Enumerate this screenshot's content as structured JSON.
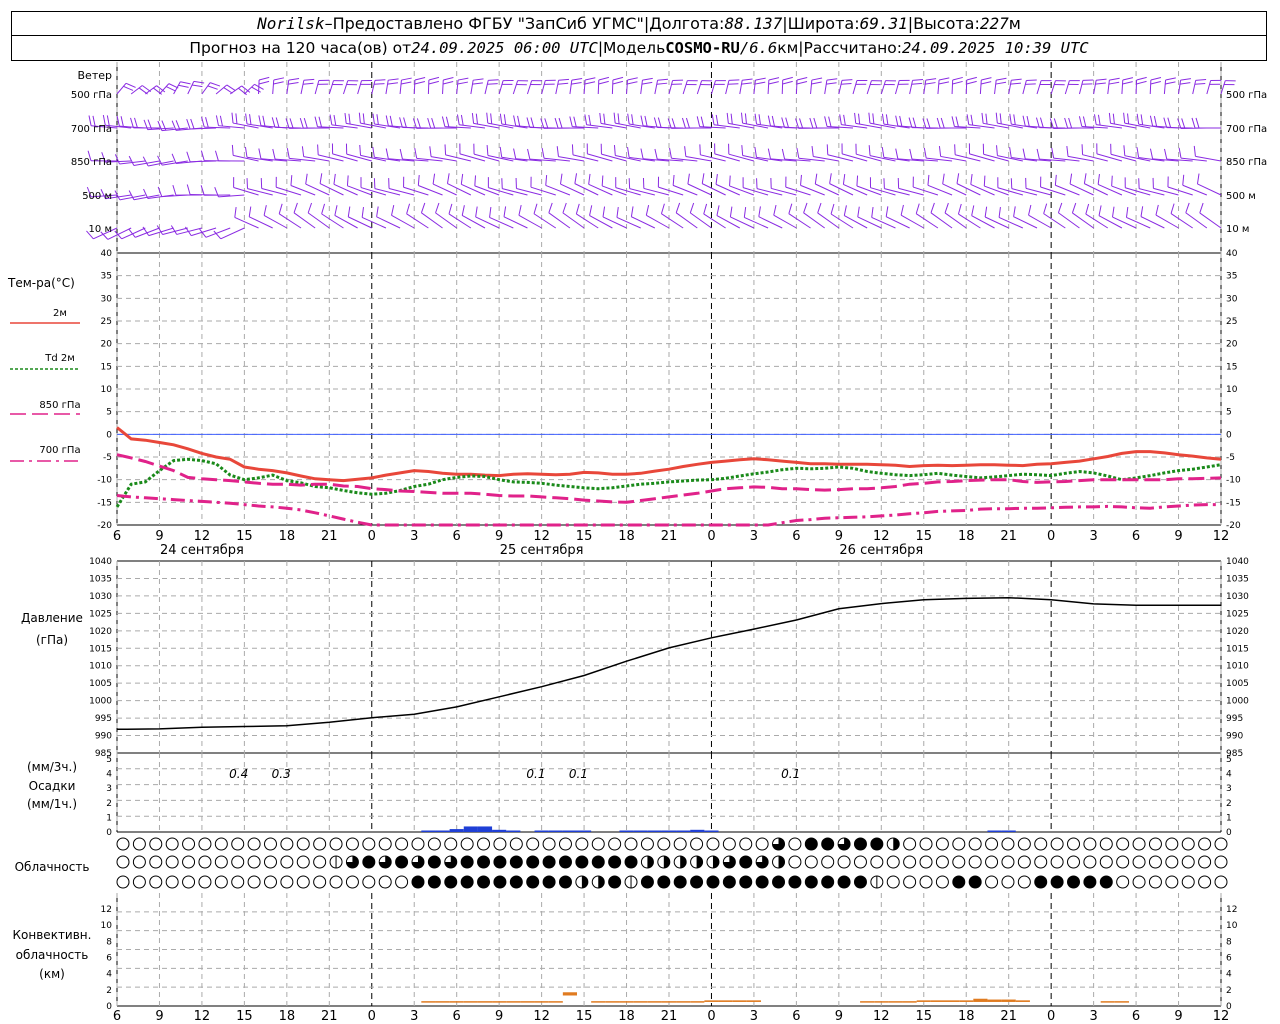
{
  "header": {
    "station": "Norilsk",
    "dash": " – ",
    "provider": "Предоставлено ФГБУ \"ЗапСиб УГМС\"",
    "sep": " | ",
    "lon_label": "Долгота: ",
    "lon_value": "88.137",
    "lat_label": "Широта: ",
    "lat_value": "69.31",
    "alt_label": "Высота: ",
    "alt_value": "227",
    "alt_unit": "м",
    "forecast_prefix": "Прогноз на 120 часа(ов) от ",
    "forecast_start": "24.09.2025 06:00 UTC",
    "model_label": "Модель ",
    "model_name": "COSMO-RU",
    "model_sep": " / ",
    "model_res": "6.6",
    "model_res_unit": "км",
    "computed_label": "Рассчитано: ",
    "computed_time": "24.09.2025 10:39 UTC"
  },
  "wind_panel": {
    "title": "Ветер",
    "levels": [
      "500 гПа",
      "700 гПа",
      "850 гПа",
      "500  м",
      "10   м"
    ],
    "color": "#8a2be2"
  },
  "temp_panel": {
    "title": "Тем-ра(°C)",
    "ylim": [
      -20,
      40
    ],
    "yticks": [
      40,
      35,
      30,
      25,
      20,
      15,
      10,
      5,
      0,
      -5,
      -10,
      -15,
      -20
    ]
  },
  "time_axis": {
    "hours": [
      "6",
      "9",
      "12",
      "15",
      "18",
      "21",
      "0",
      "3",
      "6",
      "9",
      "12",
      "15",
      "18",
      "21",
      "0",
      "3",
      "6",
      "9",
      "12",
      "15",
      "18",
      "21",
      "0",
      "3",
      "6",
      "9",
      "12"
    ],
    "dates": [
      "24 сентября",
      "25 сентября",
      "26 сентября"
    ]
  },
  "pressure_panel": {
    "title": "Давление",
    "unit": "(гПа)",
    "ylim": [
      985,
      1040
    ],
    "yticks": [
      1040,
      1035,
      1030,
      1025,
      1020,
      1015,
      1010,
      1005,
      1000,
      995,
      990,
      985
    ]
  },
  "precip_panel": {
    "unit_3h": "(мм/3ч.)",
    "title": "Осадки",
    "unit_1h": "(мм/1ч.)",
    "yticks": [
      5,
      4,
      3,
      2,
      1,
      0
    ],
    "labels": [
      {
        "hour": 8.6,
        "text": "0.4"
      },
      {
        "hour": 11.6,
        "text": "0.3"
      },
      {
        "hour": 29.6,
        "text": "0.1"
      },
      {
        "hour": 32.6,
        "text": "0.1"
      },
      {
        "hour": 47.6,
        "text": "0.1"
      }
    ],
    "color": "#1f3fd6"
  },
  "cloud_panel": {
    "title": "Облачность"
  },
  "conv_panel": {
    "title_line1": "Конвективн.",
    "title_line2": "облачность",
    "unit": "(км)",
    "yticks": [
      12,
      10,
      8,
      6,
      4,
      2,
      0
    ],
    "color": "#e07b20"
  },
  "chart_data": [
    {
      "type": "line",
      "title": "Тем-ра(°C)",
      "x_hours_from_start": [
        0,
        1,
        2,
        3,
        4,
        5,
        6,
        7,
        8,
        9,
        10,
        11,
        12,
        13,
        14,
        15,
        16,
        17,
        18,
        19,
        20,
        21,
        22,
        23,
        24,
        25,
        26,
        27,
        28,
        29,
        30,
        31,
        32,
        33,
        34,
        35,
        36,
        37,
        38,
        39,
        40,
        41,
        42,
        43,
        44,
        45,
        46,
        47,
        48,
        49,
        50,
        51,
        52,
        53,
        54,
        55,
        56,
        57,
        58,
        59,
        60,
        61,
        62,
        63,
        64,
        65,
        66,
        67,
        68,
        69,
        70,
        71,
        72,
        73,
        74,
        75,
        76,
        77,
        78
      ],
      "ylim": [
        -20,
        40
      ],
      "series": [
        {
          "name": "2м",
          "color": "#e8473a",
          "dash": "solid",
          "width": 3,
          "values": [
            1.5,
            -1,
            -1.3,
            -1.8,
            -2.3,
            -3.2,
            -4.2,
            -5,
            -5.5,
            -7.2,
            -7.7,
            -8,
            -8.5,
            -9.2,
            -9.8,
            -10,
            -10.2,
            -9.9,
            -9.6,
            -9,
            -8.5,
            -8,
            -8.2,
            -8.6,
            -8.8,
            -8.8,
            -9,
            -9.1,
            -8.8,
            -8.7,
            -8.8,
            -8.9,
            -8.8,
            -8.4,
            -8.5,
            -8.8,
            -8.8,
            -8.6,
            -8.1,
            -7.7,
            -7.1,
            -6.6,
            -6.2,
            -5.9,
            -5.6,
            -5.4,
            -5.6,
            -5.9,
            -6.2,
            -6.5,
            -6.5,
            -6.6,
            -6.6,
            -6.6,
            -6.7,
            -6.8,
            -7.1,
            -6.9,
            -6.8,
            -6.9,
            -6.8,
            -6.7,
            -6.7,
            -6.8,
            -6.9,
            -6.6,
            -6.5,
            -6.2,
            -5.9,
            -5.4,
            -4.9,
            -4.2,
            -3.8,
            -3.8,
            -4.1,
            -4.5,
            -4.8,
            -5.2,
            -5.5
          ]
        },
        {
          "name": "Td  2м",
          "color": "#1a8a1a",
          "dash": "dot",
          "width": 3,
          "values": [
            -16,
            -11,
            -10.5,
            -8,
            -5.8,
            -5.5,
            -5.8,
            -6.5,
            -9,
            -10,
            -9.6,
            -9,
            -10.2,
            -10.7,
            -11.5,
            -11.8,
            -12.4,
            -12.9,
            -13.2,
            -13,
            -12.4,
            -11.5,
            -11,
            -10,
            -9.5,
            -9.2,
            -9.3,
            -10,
            -10.5,
            -10.6,
            -10.8,
            -11.2,
            -11.5,
            -11.8,
            -12,
            -11.8,
            -11.4,
            -11,
            -10.8,
            -10.5,
            -10.3,
            -10.1,
            -10,
            -9.7,
            -9.2,
            -8.7,
            -8.3,
            -7.8,
            -7.5,
            -7.6,
            -7.5,
            -7.2,
            -7.5,
            -8.2,
            -8.6,
            -8.9,
            -9.1,
            -8.9,
            -8.6,
            -9,
            -9.3,
            -9.6,
            -9.4,
            -9.1,
            -8.8,
            -8.9,
            -9.1,
            -8.6,
            -8.2,
            -8.5,
            -9.2,
            -10,
            -9.6,
            -9.1,
            -8.5,
            -8,
            -7.7,
            -7.2,
            -6.7
          ]
        },
        {
          "name": "850 гПа",
          "color": "#e0228a",
          "dash": "long-dash",
          "width": 3,
          "values": [
            -4.5,
            -5.2,
            -6,
            -7,
            -8,
            -9.5,
            -9.8,
            -10,
            -10.2,
            -10.5,
            -10.8,
            -11,
            -11,
            -11.2,
            -11,
            -11,
            -11.4,
            -11.5,
            -12,
            -12.2,
            -12.5,
            -12.6,
            -12.8,
            -13,
            -13,
            -13,
            -13.2,
            -13.5,
            -13.6,
            -13.6,
            -13.8,
            -14,
            -14.2,
            -14.5,
            -14.7,
            -14.9,
            -15,
            -14.6,
            -14.2,
            -13.8,
            -13.4,
            -13,
            -12.5,
            -12,
            -11.8,
            -11.6,
            -11.7,
            -12,
            -12,
            -12.2,
            -12.3,
            -12.2,
            -12,
            -12,
            -11.8,
            -11.5,
            -11,
            -10.8,
            -10.5,
            -10.4,
            -10.2,
            -10.1,
            -10,
            -10,
            -10.4,
            -10.6,
            -10.5,
            -10.4,
            -10.2,
            -10,
            -10,
            -10,
            -10,
            -10,
            -10,
            -9.8,
            -9.8,
            -9.7,
            -9.6
          ]
        },
        {
          "name": "700 гПа",
          "color": "#e0228a",
          "dash": "dash-dot",
          "width": 3,
          "values": [
            -13.5,
            -13.8,
            -14,
            -14.2,
            -14.4,
            -14.6,
            -14.8,
            -15,
            -15.2,
            -15.5,
            -15.8,
            -16,
            -16.3,
            -16.7,
            -17.3,
            -18,
            -18.7,
            -19.4,
            -20,
            -20.5,
            -21,
            -21.5,
            -22,
            -22,
            -22,
            -22,
            -22,
            -22,
            -22,
            -22,
            -22,
            -22,
            -22,
            -22,
            -22,
            -22,
            -22,
            -22,
            -22,
            -22,
            -22,
            -22,
            -22,
            -22,
            -22.2,
            -22,
            -20.8,
            -19.5,
            -19,
            -18.8,
            -18.5,
            -18.4,
            -18.3,
            -18.2,
            -18,
            -17.8,
            -17.5,
            -17.3,
            -17,
            -16.9,
            -16.8,
            -16.5,
            -16.4,
            -16.4,
            -16.3,
            -16.3,
            -16.2,
            -16.1,
            -16,
            -16,
            -15.9,
            -16,
            -16.2,
            -16.3,
            -16,
            -15.8,
            -15.6,
            -15.5,
            -15.5
          ]
        }
      ]
    },
    {
      "type": "line",
      "title": "Давление",
      "ylim": [
        985,
        1040
      ],
      "x_hours_from_start": [
        0,
        3,
        6,
        9,
        12,
        15,
        18,
        21,
        24,
        27,
        30,
        33,
        36,
        39,
        42,
        45,
        48,
        51,
        54,
        57,
        60,
        63,
        66,
        69,
        72,
        75,
        78
      ],
      "series": [
        {
          "name": "Давление",
          "color": "#000000",
          "values": [
            991.8,
            991.9,
            992.4,
            992.6,
            992.8,
            993.8,
            995.1,
            996.1,
            998.2,
            1001.1,
            1004,
            1007.2,
            1011.3,
            1015.1,
            1018,
            1020.5,
            1023.1,
            1026.3,
            1027.8,
            1028.9,
            1029.3,
            1029.5,
            1028.9,
            1027.7,
            1027.3,
            1027.3,
            1027.3
          ]
        }
      ]
    },
    {
      "type": "bar",
      "title": "Осадки",
      "ylim": [
        0,
        5
      ],
      "x_hours_from_start": [
        22,
        23,
        24,
        25,
        26,
        27,
        28,
        30,
        31,
        32,
        33,
        36,
        37,
        38,
        39,
        40,
        41,
        42,
        62,
        63
      ],
      "values": [
        0.03,
        0.1,
        0.2,
        0.38,
        0.38,
        0.15,
        0.05,
        0.02,
        0.03,
        0.05,
        0.05,
        0.02,
        0.03,
        0.03,
        0.05,
        0.1,
        0.15,
        0.06,
        0.1,
        0.1
      ]
    },
    {
      "type": "bar",
      "title": "Конвективн. облачность",
      "ylim": [
        0,
        13
      ],
      "x_hours_from_start": [
        22,
        23,
        24,
        25,
        26,
        27,
        28,
        29,
        30,
        31,
        32,
        34,
        35,
        36,
        37,
        38,
        39,
        40,
        41,
        42,
        43,
        44,
        45,
        53,
        54,
        55,
        56,
        57,
        58,
        59,
        60,
        61,
        62,
        63,
        64,
        70,
        71
      ],
      "values": [
        0.6,
        0.6,
        0.6,
        0.6,
        0.6,
        0.6,
        0.6,
        0.6,
        0.6,
        0.6,
        1.7,
        0.6,
        0.6,
        0.6,
        0.6,
        0.6,
        0.6,
        0.6,
        0.6,
        0.7,
        0.7,
        0.7,
        0.7,
        0.6,
        0.6,
        0.6,
        0.6,
        0.7,
        0.7,
        0.7,
        0.7,
        0.9,
        0.8,
        0.8,
        0.7,
        0.6,
        0.6
      ]
    }
  ],
  "cloud_rows": [
    "00000000000000000000000000000000000000003044344200000000000000000000",
    "00000000000001343434344444444444222223432000000000000000000000000000",
    "00000000000000000044444444442241444444444444441000044000444440000000"
  ]
}
